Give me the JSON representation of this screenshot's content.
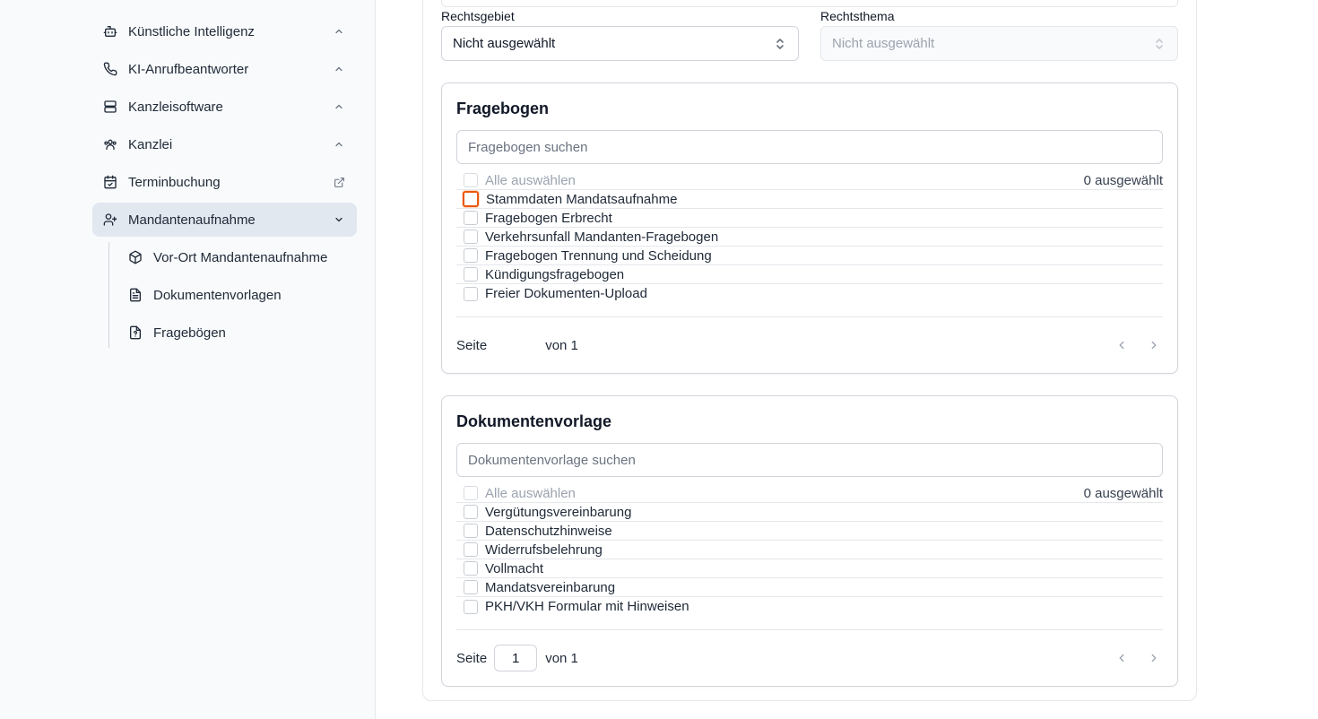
{
  "sidebar": {
    "items": [
      {
        "label": "Künstliche Intelligenz",
        "icon": "robot-icon",
        "trail": "chevron-up-icon"
      },
      {
        "label": "KI-Anrufbeantworter",
        "icon": "phone-icon",
        "trail": "chevron-up-icon"
      },
      {
        "label": "Kanzleisoftware",
        "icon": "server-icon",
        "trail": "chevron-up-icon"
      },
      {
        "label": "Kanzlei",
        "icon": "users-icon",
        "trail": "chevron-up-icon"
      },
      {
        "label": "Terminbuchung",
        "icon": "calendar-icon",
        "trail": "external-link-icon"
      },
      {
        "label": "Mandantenaufnahme",
        "icon": "user-plus-icon",
        "trail": "chevron-down-icon",
        "active": true
      }
    ],
    "subitems": [
      {
        "label": "Vor-Ort Mandantenaufnahme",
        "icon": "package-icon"
      },
      {
        "label": "Dokumentenvorlagen",
        "icon": "file-text-icon"
      },
      {
        "label": "Fragebögen",
        "icon": "file-question-icon"
      }
    ]
  },
  "filters": {
    "rechtsgebiet_label": "Rechtsgebiet",
    "rechtsgebiet_value": "Nicht ausgewählt",
    "rechtsthema_label": "Rechtsthema",
    "rechtsthema_value": "Nicht ausgewählt"
  },
  "fragebogen": {
    "title": "Fragebogen",
    "search_placeholder": "Fragebogen suchen",
    "select_all": "Alle auswählen",
    "selected_count": "0 ausgewählt",
    "items": [
      "Stammdaten Mandatsaufnahme",
      "Fragebogen Erbrecht",
      "Verkehrsunfall Mandanten-Fragebogen",
      "Fragebogen Trennung und Scheidung",
      "Kündigungsfragebogen",
      "Freier Dokumenten-Upload"
    ],
    "page_label": "Seite",
    "page_value": "",
    "page_total": "von 1"
  },
  "dokumentenvorlage": {
    "title": "Dokumentenvorlage",
    "search_placeholder": "Dokumentenvorlage suchen",
    "select_all": "Alle auswählen",
    "selected_count": "0 ausgewählt",
    "items": [
      "Vergütungsvereinbarung",
      "Datenschutzhinweise",
      "Widerrufsbelehrung",
      "Vollmacht",
      "Mandatsvereinbarung",
      "PKH/VKH Formular mit Hinweisen"
    ],
    "page_label": "Seite",
    "page_value": "1",
    "page_total": "von 1"
  },
  "colors": {
    "focus_ring": "#ea580c",
    "active_nav": "#e2e8f0",
    "sidebar_bg": "#f8fafc"
  }
}
